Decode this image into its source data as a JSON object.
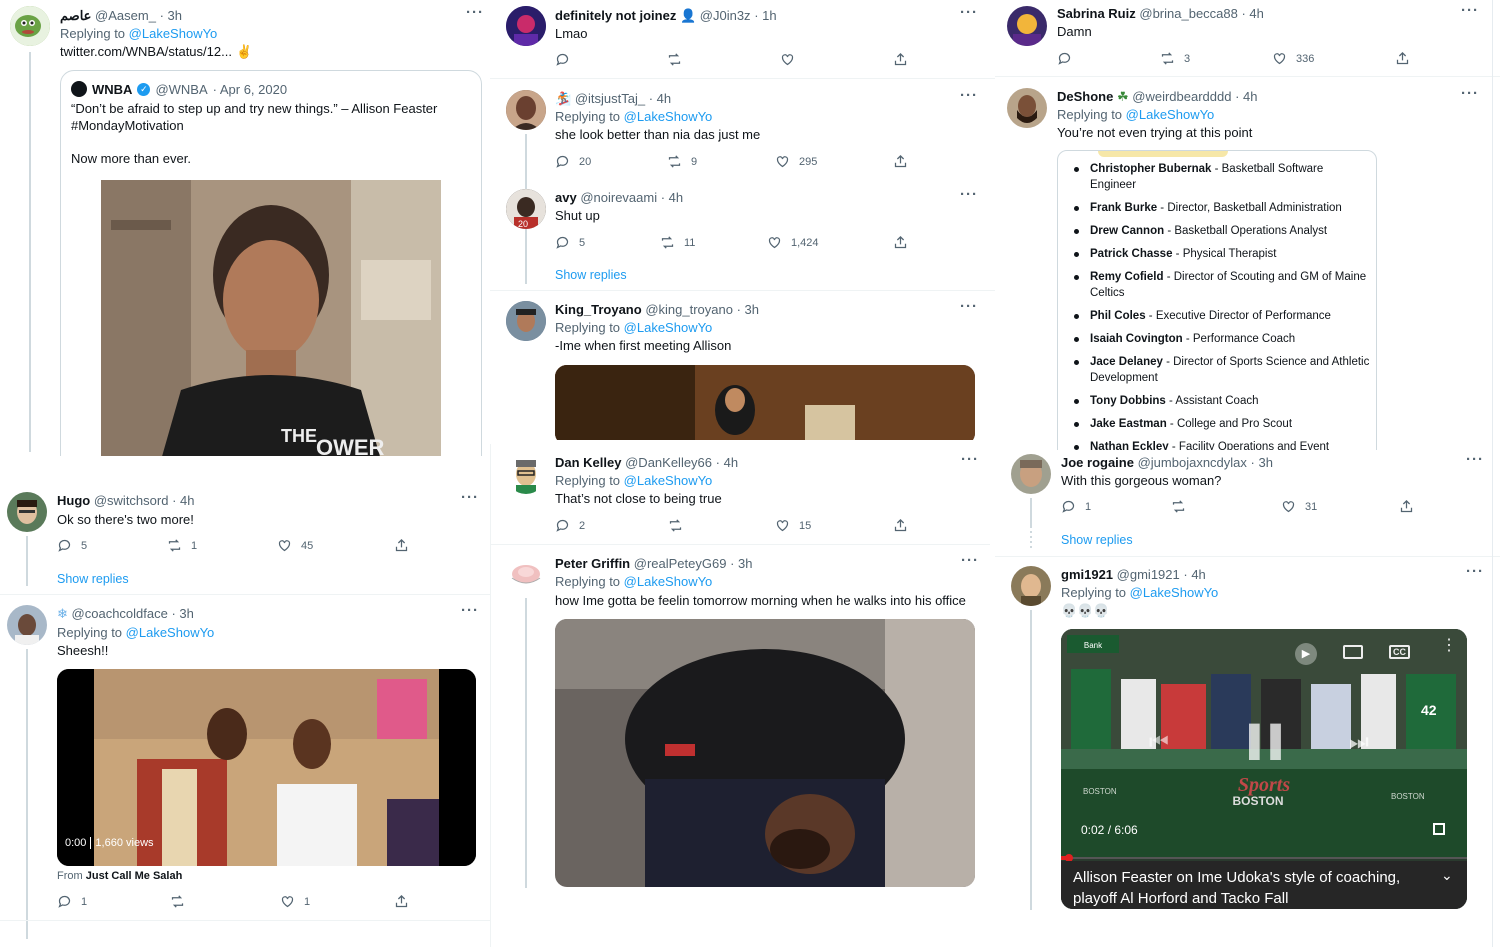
{
  "colors": {
    "accent": "#1d9bf0",
    "muted": "#536471",
    "text": "#0f1419",
    "border": "#cfd9de"
  },
  "icons": {
    "more": "more-horizontal-icon",
    "reply": "reply-bubble-icon",
    "retweet": "retweet-icon",
    "like": "heart-icon",
    "share": "share-icon"
  },
  "p1": {
    "name": "عاصم",
    "handle": "@Aasem_",
    "time": "· 3h",
    "reply_label": "Replying to",
    "reply_handle": "@LakeShowYo",
    "link": "twitter.com/WNBA/status/12...",
    "quote": {
      "name": "WNBA",
      "handle": "@WNBA",
      "time": "· Apr 6, 2020",
      "line1": "“Don’t be afraid to step up and try new things.” – Allison Feaster",
      "line2": "#MondayMotivation",
      "line3": "Now more than ever.",
      "shirt_text": "THE",
      "shirt_text2": "OWER"
    }
  },
  "p2": {
    "name": "definitely not joinez",
    "handle": "@J0in3z",
    "time": "· 1h",
    "text": "Lmao"
  },
  "p2b": {
    "name": "",
    "handle": "@itsjustTaj_",
    "time": "· 4h",
    "reply_label": "Replying to",
    "reply_handle": "@LakeShowYo",
    "text": "she look better than nia das just me",
    "replies": "20",
    "retweets": "9",
    "likes": "295"
  },
  "p2c": {
    "name": "avy",
    "handle": "@noirevaami",
    "time": "· 4h",
    "text": "Shut up",
    "replies": "5",
    "retweets": "11",
    "likes": "1,424",
    "show_replies": "Show replies"
  },
  "p2d": {
    "name": "King_Troyano",
    "handle": "@king_troyano",
    "time": "· 3h",
    "reply_label": "Replying to",
    "reply_handle": "@LakeShowYo",
    "text": "-Ime when first meeting Allison"
  },
  "p3": {
    "name": "Sabrina Ruiz",
    "handle": "@brina_becca88",
    "time": "· 4h",
    "text": "Damn",
    "retweets": "3",
    "likes": "336"
  },
  "p3b": {
    "name": "DeShone",
    "handle": "@weirdbeardddd",
    "time": "· 4h",
    "reply_label": "Replying to",
    "reply_handle": "@LakeShowYo",
    "text": "You’re not even trying at this point",
    "staff": [
      {
        "n": "Christopher Bubernak",
        "r": " - Basketball Software Engineer"
      },
      {
        "n": "Frank Burke",
        "r": " - Director, Basketball Administration"
      },
      {
        "n": "Drew Cannon",
        "r": " - Basketball Operations Analyst"
      },
      {
        "n": "Patrick Chasse",
        "r": " - Physical Therapist"
      },
      {
        "n": "Remy Cofield",
        "r": " - Director of Scouting and GM of Maine Celtics"
      },
      {
        "n": "Phil Coles",
        "r": " - Executive Director of Performance"
      },
      {
        "n": "Isaiah Covington",
        "r": " - Performance Coach"
      },
      {
        "n": "Jace Delaney",
        "r": " - Director of Sports Science and Athletic Development"
      },
      {
        "n": "Tony Dobbins",
        "r": " - Assistant Coach"
      },
      {
        "n": "Jake Eastman",
        "r": " - College and Pro Scout"
      },
      {
        "n": "Nathan Eckley",
        "r": " - Facility Operations and Event Coordinator"
      }
    ]
  },
  "p4": {
    "name": "Hugo",
    "handle": "@switchsord",
    "time": "· 4h",
    "text": "Ok so there's two more!",
    "replies": "5",
    "retweets": "1",
    "likes": "45",
    "show_replies": "Show replies"
  },
  "p4b": {
    "name": "",
    "handle": "@coachcoldface",
    "time": "· 3h",
    "reply_label": "Replying to",
    "reply_handle": "@LakeShowYo",
    "text": "Sheesh!!",
    "video_time": "0:00",
    "views": "1,660 views",
    "from_label": "From",
    "from_name": "Just Call Me Salah",
    "replies": "1",
    "likes": "1"
  },
  "p5": {
    "name": "Dan Kelley",
    "handle": "@DanKelley66",
    "time": "· 4h",
    "reply_label": "Replying to",
    "reply_handle": "@LakeShowYo",
    "text": "That’s not close to being true",
    "replies": "2",
    "likes": "15"
  },
  "p5b": {
    "name": "Peter Griffin",
    "handle": "@realPeteyG69",
    "time": "· 3h",
    "reply_label": "Replying to",
    "reply_handle": "@LakeShowYo",
    "text": "how Ime gotta be feelin tomorrow morning when he walks into his office"
  },
  "p6": {
    "name": "Joe rogaine",
    "handle": "@jumbojaxncdylax",
    "time": "· 3h",
    "text": "With this gorgeous woman?",
    "replies": "1",
    "likes": "31",
    "show_replies": "Show replies"
  },
  "p6b": {
    "name": "gmi1921",
    "handle": "@gmi1921",
    "time": "· 4h",
    "reply_label": "Replying to",
    "reply_handle": "@LakeShowYo",
    "text": "💀💀💀",
    "video_time": "0:02 / 6:06",
    "caption1": "Allison Feaster on Ime Udoka's style of coaching,",
    "caption2": "playoff Al Horford and Tacko Fall",
    "bank": "Bank",
    "sports": "Sports",
    "boston": "BOSTON",
    "jersey": "42",
    "bottom_left": "BOSTON",
    "bottom_right": "BOSTON"
  }
}
